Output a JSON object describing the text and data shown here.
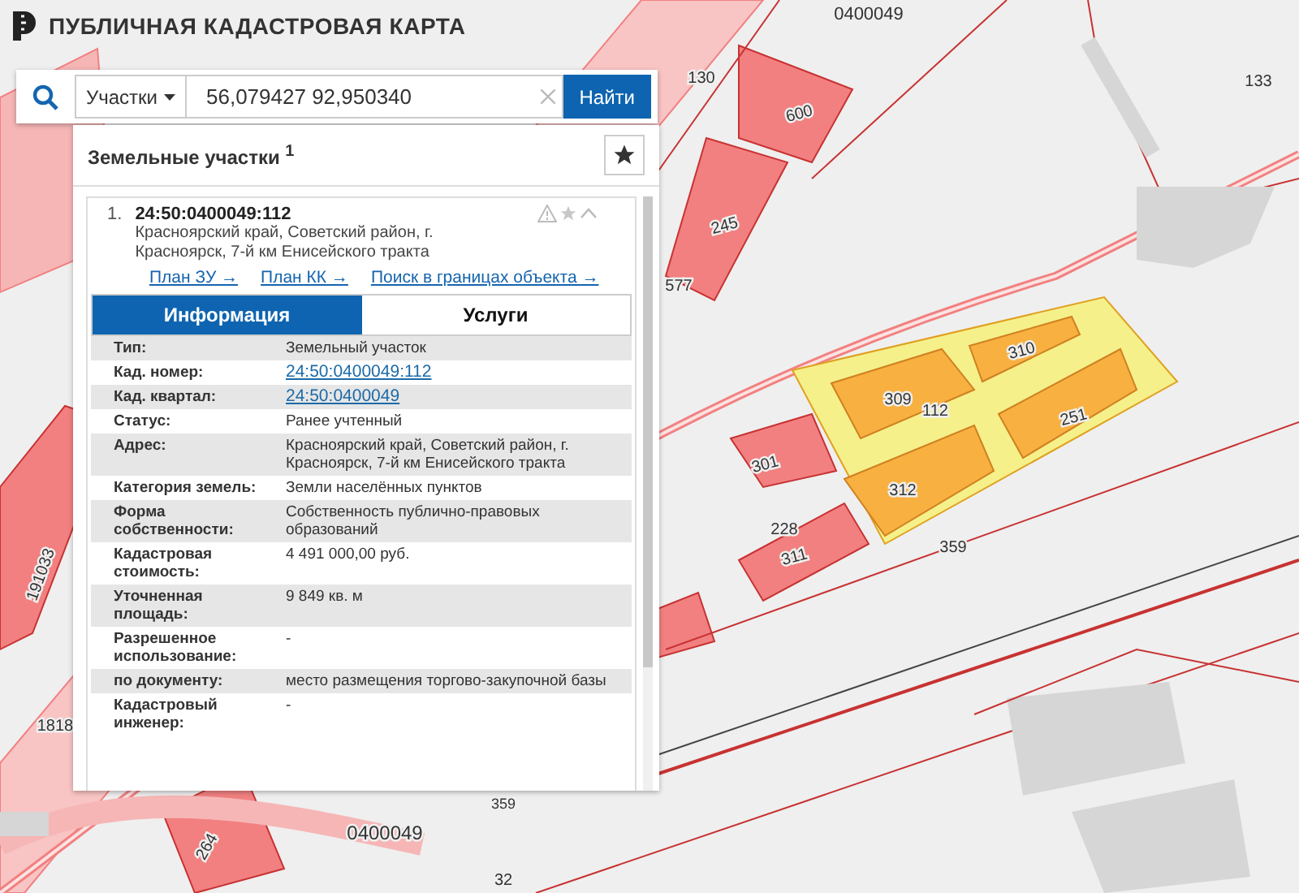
{
  "header": {
    "title": "ПУБЛИЧНАЯ КАДАСТРОВАЯ КАРТА"
  },
  "search": {
    "category": "Участки",
    "value": "56,079427 92,950340",
    "button": "Найти"
  },
  "results": {
    "title": "Земельные участки $^{1}$",
    "item": {
      "index": "1.",
      "number": "24:50:0400049:112",
      "address": "Красноярский край, Советский район, г. Красноярск, 7-й км Енисейского тракта",
      "links": [
        "План ЗУ →",
        "План КК →",
        "Поиск в границах объекта →"
      ],
      "tabs": [
        {
          "label": "Информация",
          "selected": true
        },
        {
          "label": "Услуги",
          "selected": false
        }
      ],
      "details": [
        {
          "label": "Тип:",
          "value": "Земельный участок",
          "kind": "text"
        },
        {
          "label": "Кад. номер:",
          "value": "24:50:0400049:112",
          "kind": "link"
        },
        {
          "label": "Кад. квартал:",
          "value": "24:50:0400049",
          "kind": "link"
        },
        {
          "label": "Статус:",
          "value": "Ранее учтенный",
          "kind": "text"
        },
        {
          "label": "Адрес:",
          "value": "Красноярский край, Советский район, г. Красноярск, 7-й км Енисейского тракта",
          "kind": "text"
        },
        {
          "label": "Категория земель:",
          "value": "Земли населённых пунктов",
          "kind": "text"
        },
        {
          "label": "Форма собственности:",
          "value": "Собственность публично-правовых образований",
          "kind": "text"
        },
        {
          "label": "Кадастровая стоимость:",
          "value": "4 491 000,00 руб.",
          "kind": "text"
        },
        {
          "label": "Уточненная площадь:",
          "value": "9 849 кв. м",
          "kind": "text"
        },
        {
          "label": "Разрешенное использование:",
          "value": "-",
          "kind": "text"
        },
        {
          "label": "по документу:",
          "value": "место размещения торгово-закупочной базы",
          "kind": "text"
        },
        {
          "label": "Кадастровый инженер:",
          "value": "-",
          "kind": "text"
        }
      ]
    }
  },
  "map": {
    "labels": [
      "0400049",
      "130",
      "133",
      "600",
      "245",
      "577",
      "310",
      "309",
      "112",
      "251",
      "301",
      "312",
      "228",
      "311",
      "359",
      "191033",
      "1818",
      "264",
      "0400049",
      "359",
      "32"
    ]
  }
}
